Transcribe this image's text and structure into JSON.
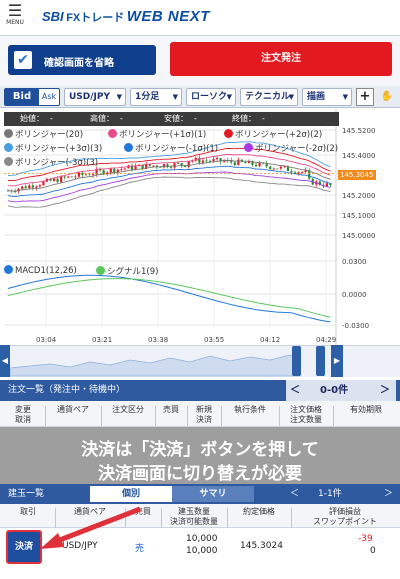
{
  "header": {
    "menu_label": "MENU",
    "logo_sbi": "SBI",
    "logo_fx": "FXトレード",
    "logo_product": "WEB NEXT"
  },
  "actions": {
    "confirm_skip_label": "確認画面を省略",
    "order_button_label": "注文発注"
  },
  "toolbar": {
    "bid_label": "Bid",
    "ask_label": "Ask",
    "pair": "USD/JPY",
    "timeframe": "1分足",
    "chart_type": "ローソク",
    "technical": "テクニカル",
    "draw": "描画",
    "plus": "+"
  },
  "ohlc": {
    "open_label": "始値：",
    "open_value": "-",
    "high_label": "高値：",
    "high_value": "-",
    "low_label": "安値：",
    "low_value": "-",
    "close_label": "終値：",
    "close_value": "-"
  },
  "legend": [
    {
      "label": "ボリンジャー(20)",
      "color": "#777777"
    },
    {
      "label": "ボリンジャー(+1σ)(1)",
      "color": "#e84b8a"
    },
    {
      "label": "ボリンジャー(+2σ)(2)",
      "color": "#e01b24"
    },
    {
      "label": "ボリンジャー(+3σ)(3)",
      "color": "#4a9fe0"
    },
    {
      "label": "ボリンジャー(-1σ)(1)",
      "color": "#2277d8"
    },
    {
      "label": "ボリンジャー(-2σ)(2)",
      "color": "#a53be0"
    },
    {
      "label": "ボリンジャー(-3σ)(3)",
      "color": "#888888"
    }
  ],
  "price_axis": [
    "145.5200",
    "145.4000",
    "145.3045",
    "145.2000",
    "145.1000",
    "145.0000"
  ],
  "current_price": "145.3045",
  "macd": {
    "legend_macd": "MACD1(12,26)",
    "legend_signal": "シグナル1(9)",
    "macd_color": "#2277d8",
    "signal_color": "#5cc85c",
    "axis": [
      "0.0300",
      "0.0000",
      "-0.0300"
    ]
  },
  "time_axis": [
    "03:04",
    "03:21",
    "03:38",
    "03:55",
    "04:12",
    "04:29"
  ],
  "order_list": {
    "title": "注文一覧（発注中・待機中）",
    "count": "0-0件",
    "columns": [
      "変更\n取消",
      "通貨ペア",
      "注文区分",
      "売買",
      "新規\n決済",
      "執行条件",
      "注文価格\n注文数量",
      "有効期限"
    ]
  },
  "annotation": {
    "line1": "決済は「決済」ボタンを押して",
    "line2": "決済画面に切り替えが必要"
  },
  "position_list": {
    "title": "建玉一覧",
    "tab_individual": "個別",
    "tab_summary": "サマリ",
    "count": "1-1件",
    "columns": [
      "取引",
      "通貨ペア",
      "売買",
      "建玉数量\n決済可能数量",
      "約定価格",
      "評価損益\nスワップポイント"
    ],
    "rows": [
      {
        "action": "決済",
        "pair": "USD/JPY",
        "side": "売",
        "qty": "10,000",
        "settleable": "10,000",
        "price": "145.3024",
        "pnl": "-39",
        "swap": "0"
      }
    ]
  },
  "colors": {
    "navy": "#1e4f9e",
    "red": "#e2191f",
    "bull": "#e01b24",
    "bear": "#2c8a2c"
  }
}
